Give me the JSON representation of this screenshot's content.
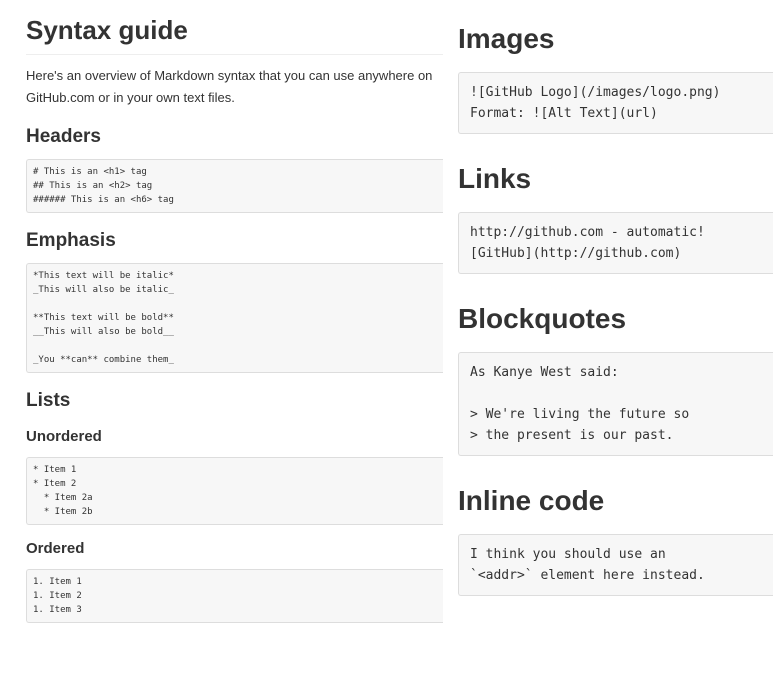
{
  "left": {
    "title": "Syntax guide",
    "intro": "Here's an overview of Markdown syntax that you can use anywhere on GitHub.com or in your own text files.",
    "headers": {
      "heading": "Headers",
      "code": "# This is an <h1> tag\n## This is an <h2> tag\n###### This is an <h6> tag"
    },
    "emphasis": {
      "heading": "Emphasis",
      "code": "*This text will be italic*\n_This will also be italic_\n\n**This text will be bold**\n__This will also be bold__\n\n_You **can** combine them_"
    },
    "lists": {
      "heading": "Lists",
      "unordered": {
        "heading": "Unordered",
        "code": "* Item 1\n* Item 2\n  * Item 2a\n  * Item 2b"
      },
      "ordered": {
        "heading": "Ordered",
        "code": "1. Item 1\n1. Item 2\n1. Item 3"
      }
    }
  },
  "right": {
    "images": {
      "heading": "Images",
      "code": "![GitHub Logo](/images/logo.png)\nFormat: ![Alt Text](url)"
    },
    "links": {
      "heading": "Links",
      "code": "http://github.com - automatic!\n[GitHub](http://github.com)"
    },
    "blockquotes": {
      "heading": "Blockquotes",
      "code": "As Kanye West said:\n\n> We're living the future so\n> the present is our past."
    },
    "inline_code": {
      "heading": "Inline code",
      "code": "I think you should use an\n`<addr>` element here instead."
    }
  }
}
